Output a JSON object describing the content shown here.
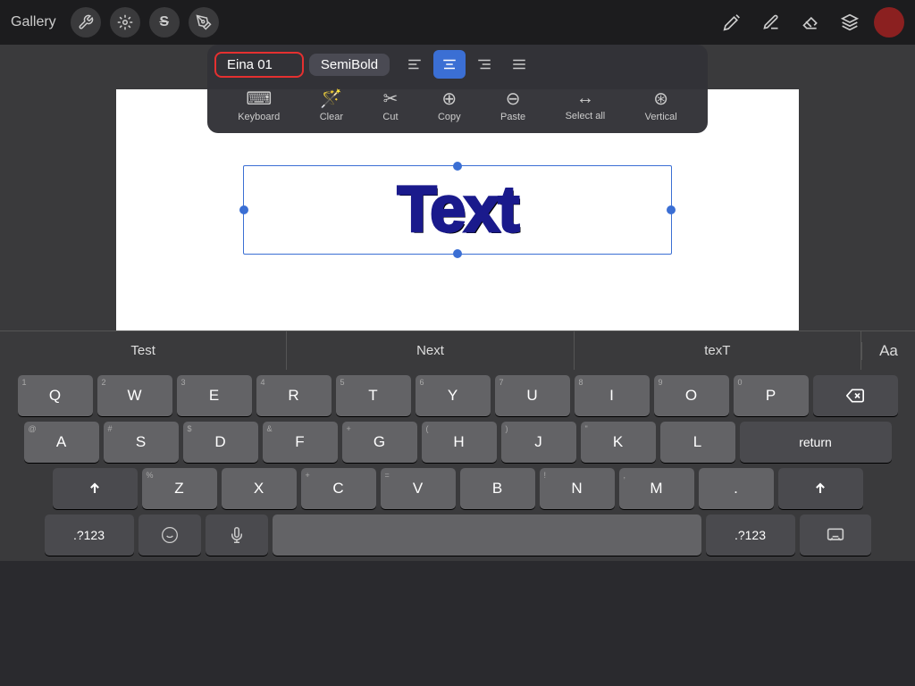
{
  "topbar": {
    "gallery_label": "Gallery",
    "font_name": "Eina 01",
    "font_style": "SemiBold"
  },
  "toolbar": {
    "keyboard_label": "Keyboard",
    "clear_label": "Clear",
    "cut_label": "Cut",
    "copy_label": "Copy",
    "paste_label": "Paste",
    "select_all_label": "Select all",
    "vertical_label": "Vertical"
  },
  "canvas": {
    "text": "Text"
  },
  "autocorrect": {
    "item1": "Test",
    "item2": "Next",
    "item3": "texT",
    "aa_label": "Aa"
  },
  "keyboard": {
    "row1": [
      {
        "label": "Q",
        "num": "1"
      },
      {
        "label": "W",
        "num": "2"
      },
      {
        "label": "E",
        "num": "3"
      },
      {
        "label": "R",
        "num": "4"
      },
      {
        "label": "T",
        "num": "5"
      },
      {
        "label": "Y",
        "num": "6"
      },
      {
        "label": "U",
        "num": "7"
      },
      {
        "label": "I",
        "num": "8"
      },
      {
        "label": "O",
        "num": "9"
      },
      {
        "label": "P",
        "num": "0"
      }
    ],
    "row2": [
      {
        "label": "A",
        "sym": "@"
      },
      {
        "label": "S",
        "sym": "#"
      },
      {
        "label": "D",
        "sym": "$"
      },
      {
        "label": "F",
        "sym": "&"
      },
      {
        "label": "G",
        "sym": "+"
      },
      {
        "label": "H",
        "sym": "("
      },
      {
        "label": "J",
        "sym": ")"
      },
      {
        "label": "K",
        "sym": "\""
      },
      {
        "label": "L",
        "sym": ""
      }
    ],
    "row3": [
      {
        "label": "Z",
        "sym": "%"
      },
      {
        "label": "X",
        "sym": ""
      },
      {
        "label": "C",
        "sym": "+"
      },
      {
        "label": "V",
        "sym": "="
      },
      {
        "label": "B",
        "sym": ""
      },
      {
        "label": "N",
        "sym": "!"
      },
      {
        "label": "M",
        "sym": ","
      },
      {
        "label": ".",
        "sym": ""
      }
    ]
  },
  "colors": {
    "accent_blue": "#3b6fd4",
    "selection_border": "#3b6fd4",
    "text_color": "#1a1a8c",
    "keyboard_bg": "#3a3a3c",
    "key_bg": "#636366",
    "special_key_bg": "#4a4a4e",
    "top_bar_bg": "#1c1c1e"
  }
}
